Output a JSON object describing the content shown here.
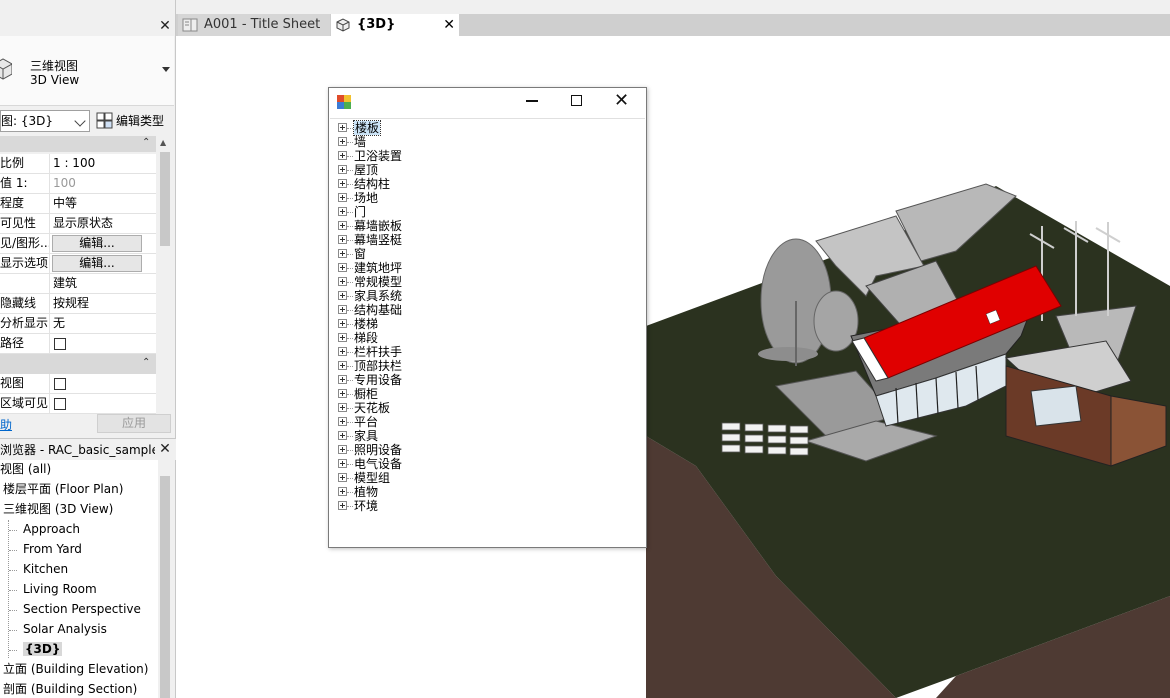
{
  "properties_panel": {
    "type_name_cn": "三维视图",
    "type_name_en": "3D View",
    "view_selector": "图: {3D}",
    "edit_type_label": "编辑类型",
    "rows": [
      {
        "label": "比例",
        "value": "1 : 100",
        "kind": "text"
      },
      {
        "label": "值 1:",
        "value": "100",
        "kind": "gray"
      },
      {
        "label": "程度",
        "value": "中等",
        "kind": "text"
      },
      {
        "label": "可见性",
        "value": "显示原状态",
        "kind": "text"
      },
      {
        "label": "见/图形...",
        "value": "编辑...",
        "kind": "button"
      },
      {
        "label": "显示选项",
        "value": "编辑...",
        "kind": "button"
      },
      {
        "label": "",
        "value": "建筑",
        "kind": "text"
      },
      {
        "label": "隐藏线",
        "value": "按规程",
        "kind": "text"
      },
      {
        "label": "分析显示...",
        "value": "无",
        "kind": "text"
      },
      {
        "label": "路径",
        "value": "",
        "kind": "check"
      }
    ],
    "rows2": [
      {
        "label": "视图",
        "kind": "check"
      },
      {
        "label": "区域可见",
        "kind": "check"
      }
    ],
    "help_link": "助",
    "apply_label": "应用"
  },
  "project_browser": {
    "title": "浏览器 - RAC_basic_sample_...",
    "items": [
      {
        "label": "视图 (all)",
        "level": 0
      },
      {
        "label": "楼层平面 (Floor Plan)",
        "level": 1
      },
      {
        "label": "三维视图 (3D View)",
        "level": 1
      },
      {
        "label": "Approach",
        "level": 2
      },
      {
        "label": "From Yard",
        "level": 2
      },
      {
        "label": "Kitchen",
        "level": 2
      },
      {
        "label": "Living Room",
        "level": 2
      },
      {
        "label": "Section Perspective",
        "level": 2
      },
      {
        "label": "Solar Analysis",
        "level": 2
      },
      {
        "label": "{3D}",
        "level": 2,
        "selected": true
      },
      {
        "label": "立面 (Building Elevation)",
        "level": 1
      },
      {
        "label": "剖面 (Building Section)",
        "level": 1
      }
    ]
  },
  "tabs": [
    {
      "label": "A001 - Title Sheet",
      "active": false
    },
    {
      "label": "{3D}",
      "active": true
    }
  ],
  "dialog": {
    "nodes": [
      "楼板",
      "墙",
      "卫浴装置",
      "屋顶",
      "结构柱",
      "场地",
      "门",
      "幕墙嵌板",
      "幕墙竖梃",
      "窗",
      "建筑地坪",
      "常规模型",
      "家具系统",
      "结构基础",
      "楼梯",
      "梯段",
      "栏杆扶手",
      "顶部扶栏",
      "专用设备",
      "橱柜",
      "天花板",
      "平台",
      "家具",
      "照明设备",
      "电气设备",
      "模型组",
      "植物",
      "环境"
    ],
    "selected_index": 0
  },
  "colors": {
    "roof_red": "#e00000",
    "terrain": "#2b321f",
    "soil": "#4e3a33",
    "panel_bg": "#f0f0f0"
  }
}
